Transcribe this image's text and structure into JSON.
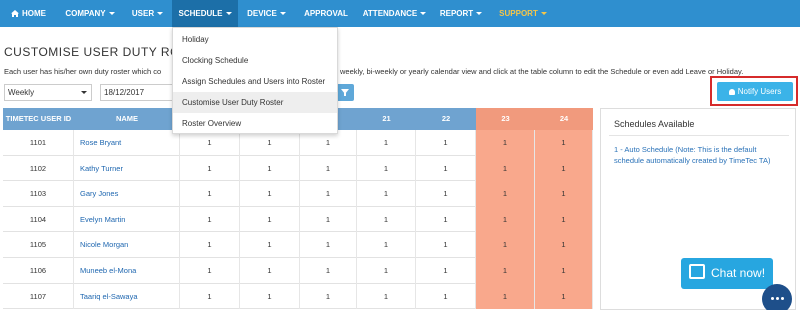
{
  "nav": {
    "home": "HOME",
    "company": "COMPANY",
    "user": "USER",
    "schedule": "SCHEDULE",
    "device": "DEVICE",
    "approval": "APPROVAL",
    "attendance": "ATTENDANCE",
    "report": "REPORT",
    "support": "SUPPORT"
  },
  "colors": {
    "navbar": "#2f8fcf",
    "nav_active": "#1c6fa8",
    "support_accent": "#f4c64a",
    "table_header": "#6fa3d0",
    "weekend_header": "#f19a7d",
    "weekend_cell": "#f9a88c",
    "link": "#1f67b0",
    "notify_button": "#3bb3e8",
    "highlight_frame": "#d62b2b",
    "chat": "#27a6e0"
  },
  "page": {
    "title": "CUSTOMISE USER DUTY ROSTER",
    "description_left": "Each user has his/her own duty roster which co",
    "description_right": "weekly, bi-weekly or yearly calendar view and click at the table column to edit the Schedule or even add Leave or Holiday."
  },
  "filters": {
    "view_selected": "Weekly",
    "date_value": "18/12/2017",
    "filter_icon": "filter-icon"
  },
  "notify_button": "Notify Users",
  "schedule_menu": [
    "Holiday",
    "Clocking Schedule",
    "Assign Schedules and Users into Roster",
    "Customise User Duty Roster",
    "Roster Overview"
  ],
  "table": {
    "headers": [
      "TIMETEC USER ID",
      "NAME",
      "",
      "",
      "",
      "21",
      "22",
      "23",
      "24"
    ],
    "rows": [
      {
        "id": "1101",
        "name": "Rose Bryant",
        "values": [
          "1",
          "1",
          "1",
          "1",
          "1",
          "1",
          "1"
        ]
      },
      {
        "id": "1102",
        "name": "Kathy Turner",
        "values": [
          "1",
          "1",
          "1",
          "1",
          "1",
          "1",
          "1"
        ]
      },
      {
        "id": "1103",
        "name": "Gary Jones",
        "values": [
          "1",
          "1",
          "1",
          "1",
          "1",
          "1",
          "1"
        ]
      },
      {
        "id": "1104",
        "name": "Evelyn Martin",
        "values": [
          "1",
          "1",
          "1",
          "1",
          "1",
          "1",
          "1"
        ]
      },
      {
        "id": "1105",
        "name": "Nicole Morgan",
        "values": [
          "1",
          "1",
          "1",
          "1",
          "1",
          "1",
          "1"
        ]
      },
      {
        "id": "1106",
        "name": "Muneeb el-Mona",
        "values": [
          "1",
          "1",
          "1",
          "1",
          "1",
          "1",
          "1"
        ]
      },
      {
        "id": "1107",
        "name": "Taariq el-Sawaya",
        "values": [
          "1",
          "1",
          "1",
          "1",
          "1",
          "1",
          "1"
        ]
      }
    ]
  },
  "side_panel": {
    "title": "Schedules Available",
    "item": "1 - Auto Schedule (Note: This is the default schedule automatically created by TimeTec TA)"
  },
  "chat": {
    "label": "Chat now!"
  }
}
